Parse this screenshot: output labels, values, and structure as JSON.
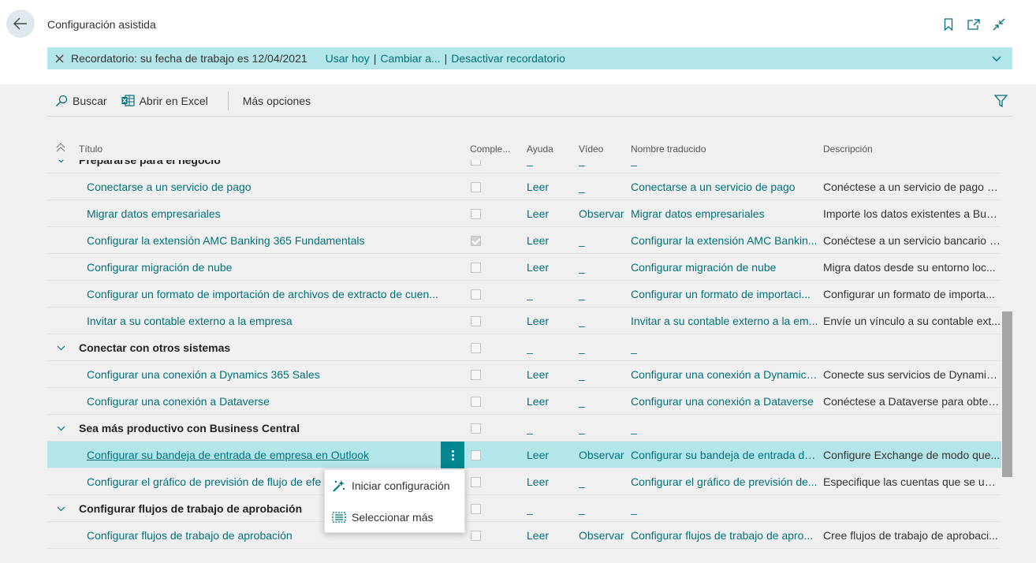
{
  "header": {
    "page_title": "Configuración asistida"
  },
  "banner": {
    "message": "Recordatorio: su fecha de trabajo es 12/04/2021",
    "links": [
      "Usar hoy",
      "Cambiar a...",
      "Desactivar recordatorio"
    ],
    "separator": "|"
  },
  "actions": {
    "search": "Buscar",
    "excel": "Abrir en Excel",
    "more": "Más opciones"
  },
  "columns": {
    "title": "Título",
    "completed": "Comple...",
    "help": "Ayuda",
    "video": "Vídeo",
    "translated": "Nombre traducido",
    "description": "Descripción"
  },
  "rows": [
    {
      "type": "group",
      "title": "Prepararse para el negocio",
      "help": "_",
      "video": "_",
      "translated": "_",
      "description": ""
    },
    {
      "type": "item",
      "title": "Conectarse a un servicio de pago",
      "completed": false,
      "help": "Leer",
      "video": "_",
      "translated": "Conectarse a un servicio de pago",
      "description": "Conéctese a un servicio de pago p..."
    },
    {
      "type": "item",
      "title": "Migrar datos empresariales",
      "completed": false,
      "help": "Leer",
      "video": "Observar",
      "translated": "Migrar datos empresariales",
      "description": "Importe los datos existentes a Busi..."
    },
    {
      "type": "item",
      "title": "Configurar la extensión AMC Banking 365 Fundamentals",
      "completed": true,
      "help": "Leer",
      "video": "_",
      "translated": "Configurar la extensión AMC Bankin...",
      "description": "Conéctese a un servicio bancario e..."
    },
    {
      "type": "item",
      "title": "Configurar migración de nube",
      "completed": false,
      "help": "Leer",
      "video": "_",
      "translated": "Configurar migración de nube",
      "description": "Migra datos desde su entorno loc..."
    },
    {
      "type": "item",
      "title": "Configurar un formato de importación de archivos de extracto de cuen...",
      "completed": false,
      "help": "_",
      "video": "_",
      "translated": "Configurar un formato de importaci...",
      "description": "Configurar un formato de importa..."
    },
    {
      "type": "item",
      "title": "Invitar a su contable externo a la empresa",
      "completed": false,
      "help": "Leer",
      "video": "_",
      "translated": "Invitar a su contable externo a la em...",
      "description": "Envíe un vínculo a su contable ext..."
    },
    {
      "type": "group",
      "title": "Conectar con otros sistemas",
      "help": "_",
      "video": "_",
      "translated": "_",
      "description": ""
    },
    {
      "type": "item",
      "title": "Configurar una conexión a Dynamics 365 Sales",
      "completed": false,
      "help": "Leer",
      "video": "_",
      "translated": "Configurar una conexión a Dynamics...",
      "description": "Conecte sus servicios de Dynamics..."
    },
    {
      "type": "item",
      "title": "Configurar una conexión a Dataverse",
      "completed": false,
      "help": "Leer",
      "video": "_",
      "translated": "Configurar una conexión a Dataverse",
      "description": "Conéctese a Dataverse para obten..."
    },
    {
      "type": "group",
      "title": "Sea más productivo con Business Central",
      "help": "_",
      "video": "_",
      "translated": "_",
      "description": ""
    },
    {
      "type": "item",
      "title": "Configurar su bandeja de entrada de empresa en Outlook",
      "completed": false,
      "help": "Leer",
      "video": "Observar",
      "translated": "Configurar su bandeja de entrada de...",
      "description": "Configure Exchange de modo que...",
      "selected": true
    },
    {
      "type": "item",
      "title": "Configurar el gráfico de previsión de flujo de efe",
      "completed": false,
      "help": "Leer",
      "video": "_",
      "translated": "Configurar el gráfico de previsión de...",
      "description": "Especifique las cuentas que se usa..."
    },
    {
      "type": "group",
      "title": "Configurar flujos de trabajo de aprobación",
      "help": "_",
      "video": "_",
      "translated": "_",
      "description": ""
    },
    {
      "type": "item",
      "title": "Configurar flujos de trabajo de aprobación",
      "completed": false,
      "help": "Leer",
      "video": "Observar",
      "translated": "Configurar flujos de trabajo de apro...",
      "description": "Cree flujos de trabajo de aprobaci..."
    }
  ],
  "context_menu": {
    "items": [
      "Iniciar configuración",
      "Seleccionar más"
    ]
  },
  "colors": {
    "accent": "#00727a",
    "banner_bg": "#b3e6ea",
    "selected_row": "#b3e6ea",
    "menu_button": "#00878f"
  }
}
